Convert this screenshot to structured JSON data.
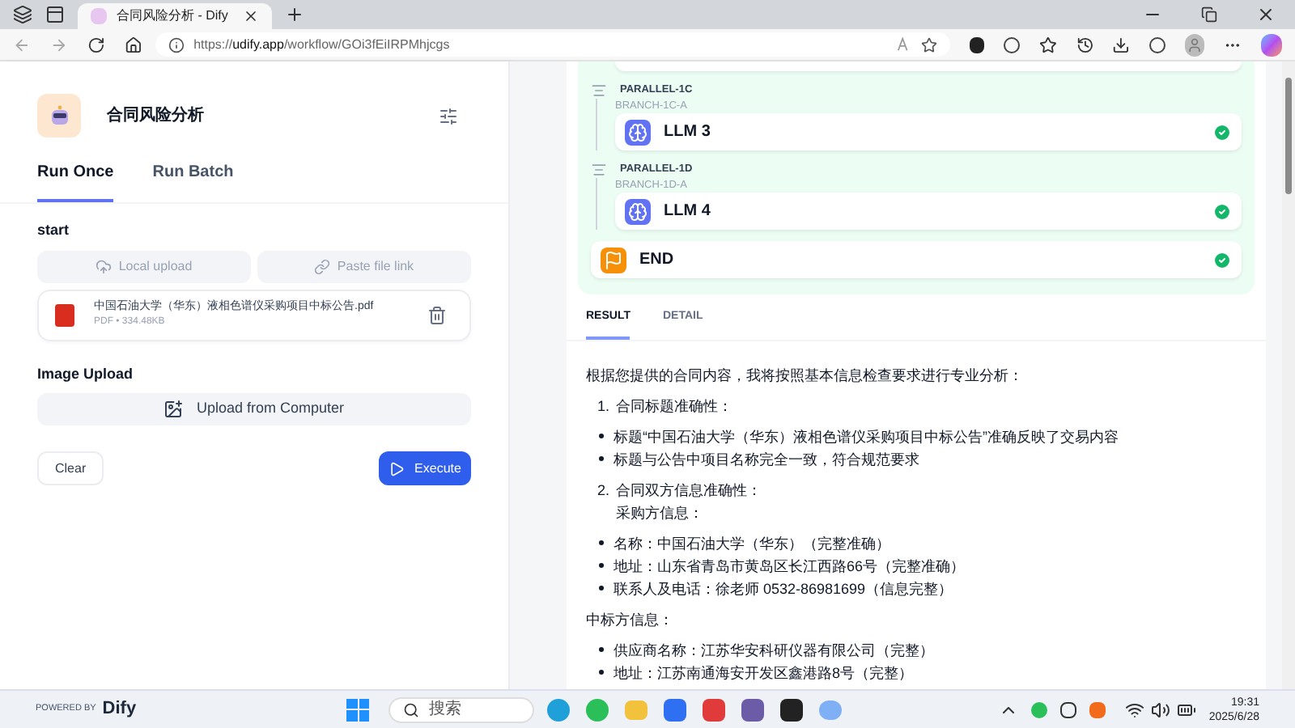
{
  "browser": {
    "tabs": [
      {
        "title": "合同风险分析 - Dify",
        "selected": true
      }
    ],
    "url": "https://**udify.app**/workflow/GOi3fEiIRPMhjcgs"
  },
  "app": {
    "name": "合同风险分析",
    "tabs": [
      {
        "label": "Run Once",
        "selected": true
      },
      {
        "label": "Run Batch",
        "selected": false
      }
    ],
    "start_label": "start",
    "upload_options": [
      {
        "label": "Local upload",
        "kind": "local",
        "disabled": true
      },
      {
        "label": "Paste file link",
        "kind": "link",
        "disabled": true
      }
    ],
    "file": {
      "name": "中国石油大学（华东）液相色谱仪采购项目中标公告.pdf",
      "meta": "PDF • 334.48KB"
    },
    "image_label": "Image Upload",
    "image_button": "Upload from Computer",
    "clear": "Clear",
    "execute": "Execute",
    "powered_by": "POWERED BY",
    "brand": "Dify"
  },
  "workflow": {
    "parallels": [
      {
        "label": "PARALLEL-1C",
        "branch": "BRANCH-1C-A",
        "node": {
          "title": "LLM 3",
          "kind": "llm",
          "succeeded": true
        }
      },
      {
        "label": "PARALLEL-1D",
        "branch": "BRANCH-1D-A",
        "node": {
          "title": "LLM 4",
          "kind": "llm",
          "succeeded": true
        }
      }
    ],
    "end": {
      "title": "END",
      "kind": "end",
      "succeeded": true
    }
  },
  "result": {
    "tabs": [
      {
        "label": "RESULT",
        "selected": true
      },
      {
        "label": "DETAIL",
        "selected": false
      }
    ],
    "blocks": [
      {
        "kind": "para",
        "text": "根据您提供的合同内容，我将按照基本信息检查要求进行专业分析："
      },
      {
        "kind": "numbered",
        "number": "1.",
        "lines": [
          "合同标题准确性："
        ]
      },
      {
        "kind": "bullets",
        "items": [
          "标题“中国石油大学（华东）液相色谱仪采购项目中标公告”准确反映了交易内容",
          "标题与公告中项目名称完全一致，符合规范要求"
        ]
      },
      {
        "kind": "numbered",
        "number": "2.",
        "lines": [
          "合同双方信息准确性：",
          "采购方信息："
        ]
      },
      {
        "kind": "bullets",
        "items": [
          "名称：中国石油大学（华东）（完整准确）",
          "地址：山东省青岛市黄岛区长江西路66号（完整准确）",
          "联系人及电话：徐老师 0532-86981699（信息完整）"
        ]
      },
      {
        "kind": "para",
        "text": "中标方信息："
      },
      {
        "kind": "bullets",
        "items": [
          "供应商名称：江苏华安科研仪器有限公司（完整）",
          "地址：江苏南通海安开发区鑫港路8号（完整）"
        ]
      }
    ]
  },
  "taskbar": {
    "search_placeholder": "搜索",
    "time": "19:31",
    "date": "2025/6/28"
  }
}
